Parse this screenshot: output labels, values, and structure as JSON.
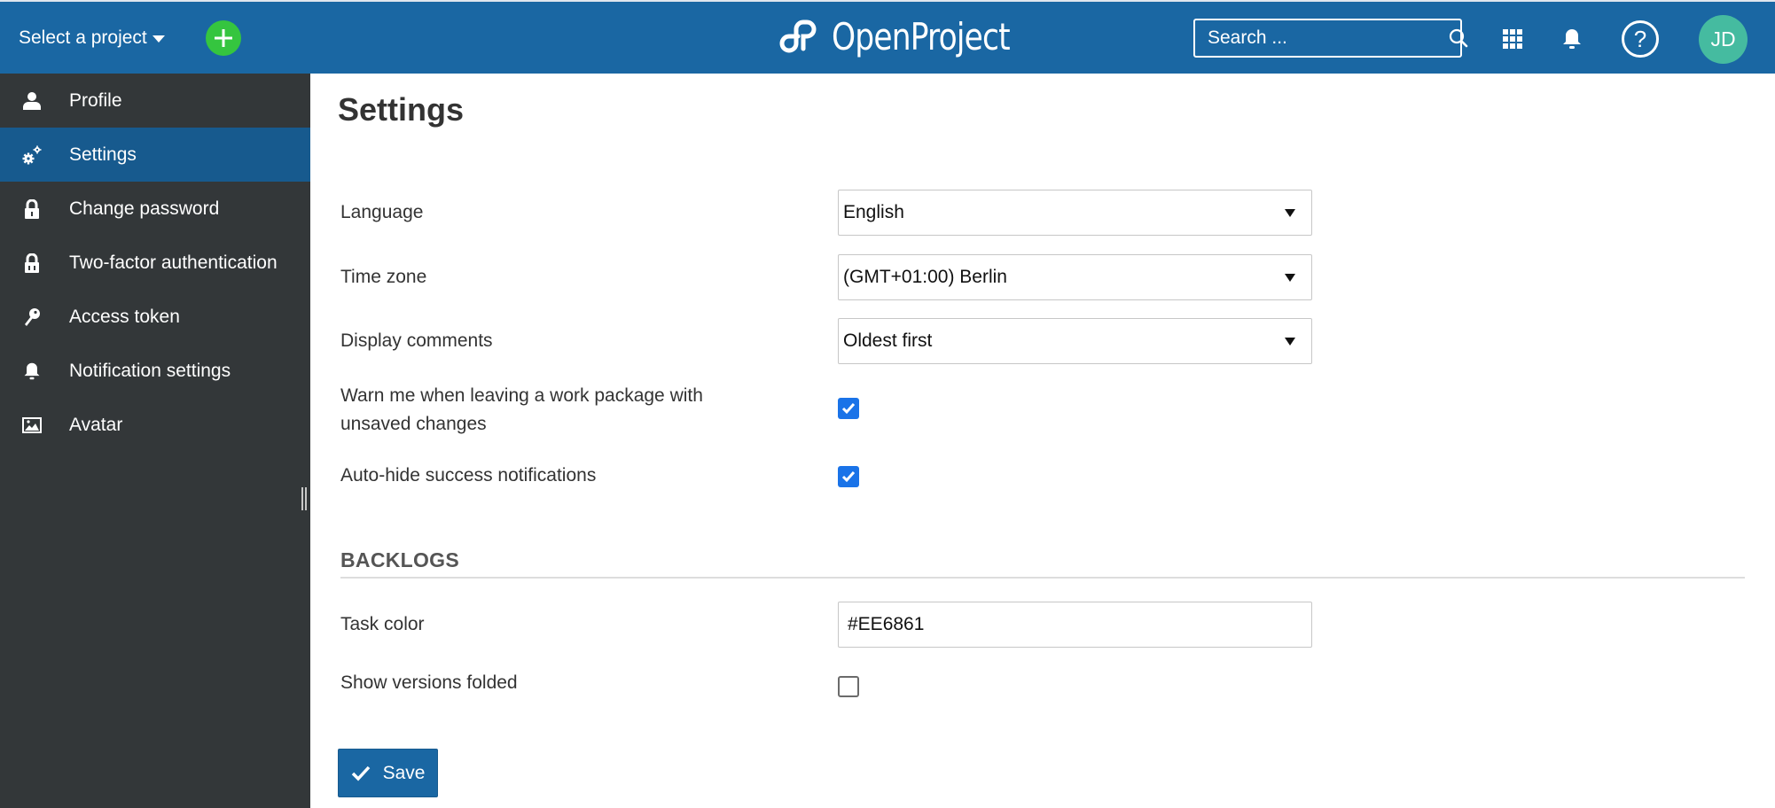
{
  "header": {
    "project_select_label": "Select a project",
    "logo_text": "OpenProject",
    "search_placeholder": "Search ...",
    "help_glyph": "?",
    "avatar_initials": "JD",
    "colors": {
      "header_bg": "#1A67A3",
      "add_button": "#35C53F",
      "avatar_bg": "#45BBA0"
    }
  },
  "sidebar": {
    "items": [
      {
        "label": "Profile",
        "icon": "user-icon",
        "active": false
      },
      {
        "label": "Settings",
        "icon": "gears-icon",
        "active": true
      },
      {
        "label": "Change password",
        "icon": "lock-icon",
        "active": false
      },
      {
        "label": "Two-factor authentication",
        "icon": "lock-two-factor-icon",
        "active": false
      },
      {
        "label": "Access token",
        "icon": "key-icon",
        "active": false
      },
      {
        "label": "Notification settings",
        "icon": "bell-icon",
        "active": false
      },
      {
        "label": "Avatar",
        "icon": "image-icon",
        "active": false
      }
    ]
  },
  "main": {
    "title": "Settings",
    "fields": {
      "language": {
        "label": "Language",
        "value": "English"
      },
      "time_zone": {
        "label": "Time zone",
        "value": "(GMT+01:00) Berlin"
      },
      "display_comments": {
        "label": "Display comments",
        "value": "Oldest first"
      },
      "warn_unsaved": {
        "label": "Warn me when leaving a work package with unsaved changes",
        "checked": true
      },
      "auto_hide": {
        "label": "Auto-hide success notifications",
        "checked": true
      }
    },
    "backlogs": {
      "section_title": "BACKLOGS",
      "task_color": {
        "label": "Task color",
        "value": "#EE6861"
      },
      "show_versions_folded": {
        "label": "Show versions folded",
        "checked": false
      }
    },
    "save_label": "Save"
  }
}
